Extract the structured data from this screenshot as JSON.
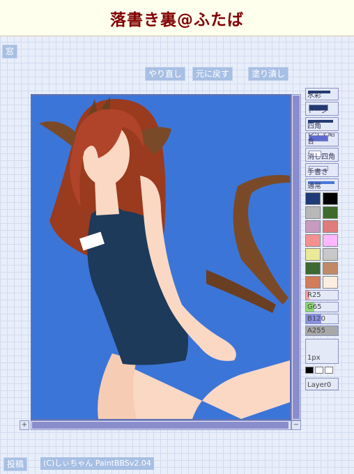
{
  "header": {
    "title": "落書き裏@ふたば"
  },
  "toolbar": {
    "window_label": "窓",
    "redo_label": "やり直し",
    "undo_label": "元に戻す",
    "fill_label": "塗り潰し"
  },
  "tools": [
    {
      "name": "tool-watercolor",
      "label": "水彩"
    },
    {
      "name": "tool-tone",
      "label": "トーン"
    },
    {
      "name": "tool-rect",
      "label": "四角"
    },
    {
      "name": "tool-blur",
      "label": "レイヤ結合"
    },
    {
      "name": "tool-fill-rect",
      "label": "消し四角"
    },
    {
      "name": "tool-handwrite",
      "label": "手書き"
    },
    {
      "name": "tool-normal",
      "label": "通常"
    }
  ],
  "colors": {
    "swatches": [
      "#1e3a78",
      "#000000",
      "#b8b8b8",
      "#3f6a2c",
      "#c89ac0",
      "#e07c7c",
      "#f59090",
      "#ffb8ff",
      "#eaea98",
      "#c8c8c8",
      "#3c6a30",
      "#c08a68",
      "#d27c5a",
      "#fbeee0"
    ],
    "canvas_bg": "#3c75d8",
    "accent": "#a7bfe3"
  },
  "sliders": {
    "r_label": "R25",
    "g_label": "G65",
    "b_label": "B120",
    "a_label": "A255",
    "r_level": 0.1,
    "g_level": 0.25,
    "b_level": 0.47,
    "a_level": 1.0
  },
  "pen": {
    "size_label": "1px"
  },
  "layer": {
    "label": "Layer0"
  },
  "scroll": {
    "plus": "+",
    "minus": "−"
  },
  "footer": {
    "post_label": "投稿",
    "credit": "(C)しぃちゃん PaintBBSv2.04"
  }
}
